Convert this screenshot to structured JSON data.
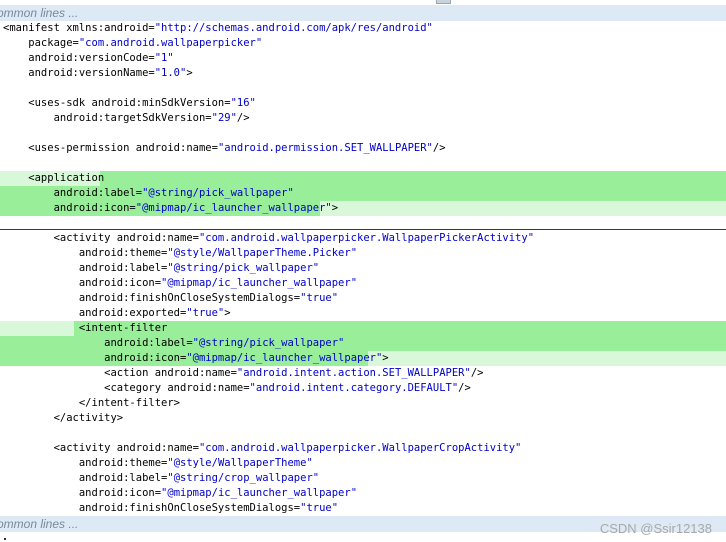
{
  "fold_marker_text": "ommon lines ...",
  "watermark": "CSDN @Ssir12138",
  "colors": {
    "highlight_strong": "#99ee99",
    "highlight_light": "#d9f7d9",
    "fold_bar": "#dde9f5",
    "divider": "#1f2fb5",
    "attr_value": "#0000c8"
  },
  "code_lines": [
    "<manifest xmlns:android=\"http://schemas.android.com/apk/res/android\"",
    "    package=\"com.android.wallpaperpicker\"",
    "    android:versionCode=\"1\"",
    "    android:versionName=\"1.0\">",
    "",
    "    <uses-sdk android:minSdkVersion=\"16\"",
    "        android:targetSdkVersion=\"29\"/>",
    "",
    "    <uses-permission android:name=\"android.permission.SET_WALLPAPER\"/>",
    "",
    "    <application",
    "        android:label=\"@string/pick_wallpaper\"",
    "        android:icon=\"@mipmap/ic_launcher_wallpaper\">",
    "",
    "        <activity android:name=\"com.android.wallpaperpicker.WallpaperPickerActivity\"",
    "            android:theme=\"@style/WallpaperTheme.Picker\"",
    "            android:label=\"@string/pick_wallpaper\"",
    "            android:icon=\"@mipmap/ic_launcher_wallpaper\"",
    "            android:finishOnCloseSystemDialogs=\"true\"",
    "            android:exported=\"true\">",
    "            <intent-filter",
    "                android:label=\"@string/pick_wallpaper\"",
    "                android:icon=\"@mipmap/ic_launcher_wallpaper\">",
    "                <action android:name=\"android.intent.action.SET_WALLPAPER\"/>",
    "                <category android:name=\"android.intent.category.DEFAULT\"/>",
    "            </intent-filter>",
    "        </activity>",
    "",
    "        <activity android:name=\"com.android.wallpaperpicker.WallpaperCropActivity\"",
    "            android:theme=\"@style/WallpaperTheme\"",
    "            android:label=\"@string/crop_wallpaper\"",
    "            android:icon=\"@mipmap/ic_launcher_wallpaper\"",
    "            android:finishOnCloseSystemDialogs=\"true\""
  ]
}
